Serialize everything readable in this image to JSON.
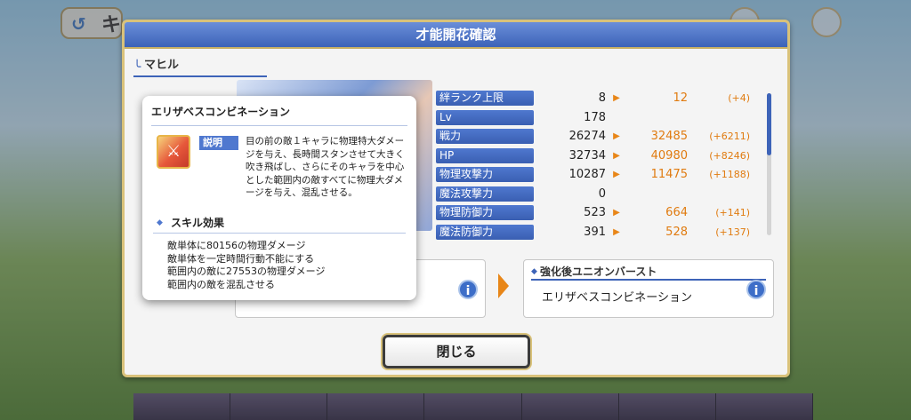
{
  "dialog": {
    "title": "才能開花確認",
    "character_name": "マヒル",
    "close_label": "閉じる"
  },
  "stats": [
    {
      "label": "絆ランク上限",
      "current": "8",
      "new": "12",
      "diff": "(+4)"
    },
    {
      "label": "Lv",
      "current": "178",
      "new": "",
      "diff": ""
    },
    {
      "label": "戦力",
      "current": "26274",
      "new": "32485",
      "diff": "(+6211)"
    },
    {
      "label": "HP",
      "current": "32734",
      "new": "40980",
      "diff": "(+8246)"
    },
    {
      "label": "物理攻撃力",
      "current": "10287",
      "new": "11475",
      "diff": "(+1188)"
    },
    {
      "label": "魔法攻撃力",
      "current": "0",
      "new": "",
      "diff": ""
    },
    {
      "label": "物理防御力",
      "current": "523",
      "new": "664",
      "diff": "(+141)"
    },
    {
      "label": "魔法防御力",
      "current": "391",
      "new": "528",
      "diff": "(+137)"
    }
  ],
  "ub_after": {
    "header": "強化後ユニオンバースト",
    "name": "エリザベスコンビネーション"
  },
  "popup": {
    "title": "エリザベスコンビネーション",
    "desc_tag": "説明",
    "description": "目の前の敵１キャラに物理特大ダメージを与え、長時間スタンさせて大きく吹き飛ばし、さらにそのキャラを中心とした範囲内の敵すべてに物理大ダメージを与え、混乱させる。",
    "effect_header": "スキル効果",
    "effects": [
      "敵単体に80156の物理ダメージ",
      "敵単体を一定時間行動不能にする",
      "範囲内の敵に27553の物理ダメージ",
      "範囲内の敵を混乱させる"
    ]
  },
  "background": {
    "top_left_label": "キ"
  }
}
